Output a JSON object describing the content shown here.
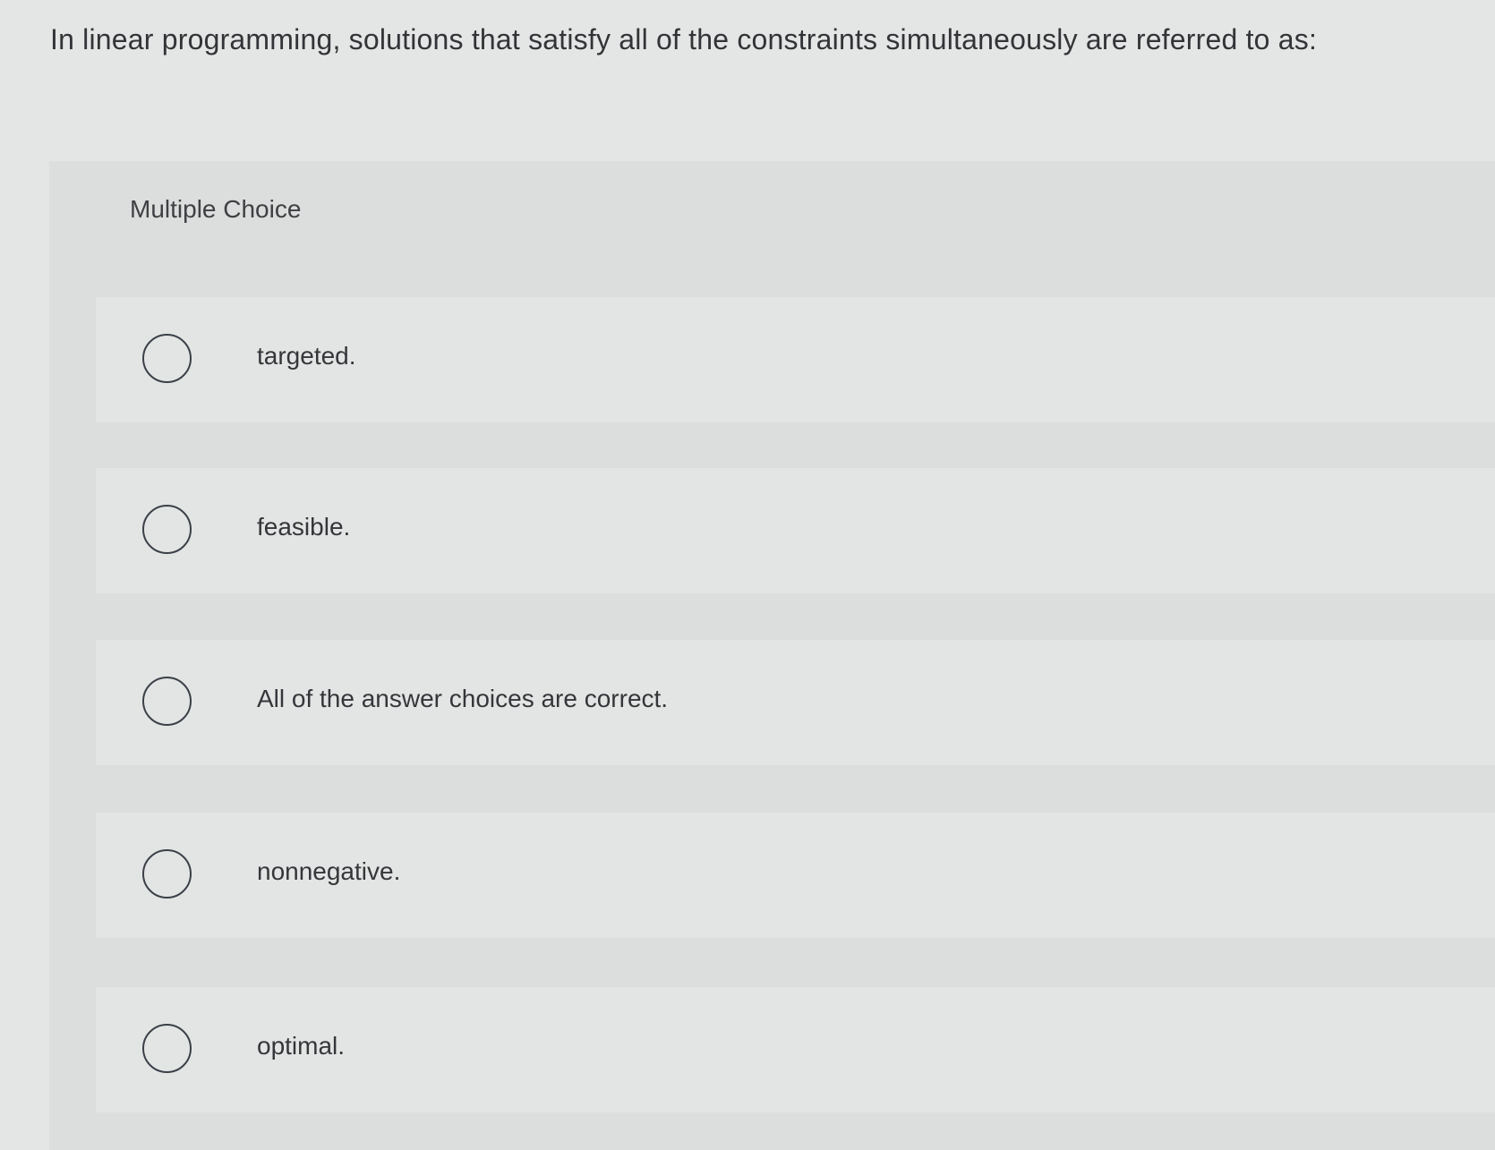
{
  "question": {
    "text": "In linear programming, solutions that satisfy all of the constraints simultaneously are referred to as:"
  },
  "multiple_choice": {
    "label": "Multiple Choice",
    "options": [
      {
        "label": "targeted.",
        "selected": false
      },
      {
        "label": "feasible.",
        "selected": false
      },
      {
        "label": "All of the answer choices are correct.",
        "selected": false
      },
      {
        "label": "nonnegative.",
        "selected": false
      },
      {
        "label": "optimal.",
        "selected": false
      }
    ]
  },
  "colors": {
    "page_background": "#e4e6e5",
    "panel_background": "#dcdede",
    "option_background": "#e3e5e4",
    "text": "#333437",
    "radio_border": "#3b4048"
  }
}
